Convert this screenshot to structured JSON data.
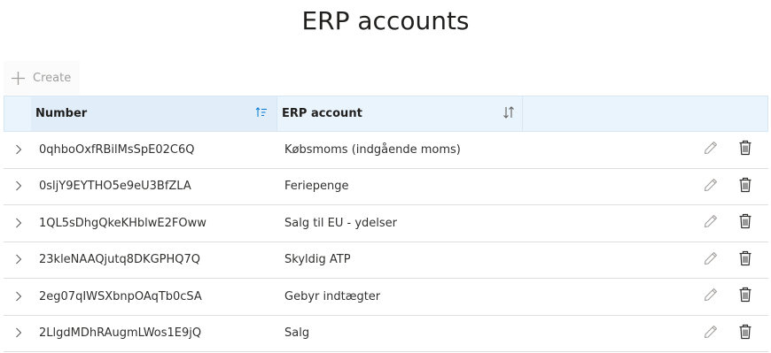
{
  "page": {
    "title": "ERP accounts"
  },
  "toolbar": {
    "create_label": "Create",
    "create_icon": "plus-icon"
  },
  "table": {
    "columns": [
      {
        "label": "Number",
        "sort": "ascending",
        "icon": "sort-ascending-icon"
      },
      {
        "label": "ERP account",
        "sort": "none",
        "icon": "sort-icon"
      }
    ],
    "rows": [
      {
        "number": "0qhboOxfRBilMsSpE02C6Q",
        "erp_account": "Købsmoms (indgående moms)"
      },
      {
        "number": "0sljY9EYTHO5e9eU3BfZLA",
        "erp_account": "Feriepenge"
      },
      {
        "number": "1QL5sDhgQkeKHblwE2FOww",
        "erp_account": "Salg til EU - ydelser"
      },
      {
        "number": "23kleNAAQjutq8DKGPHQ7Q",
        "erp_account": "Skyldig ATP"
      },
      {
        "number": "2eg07qIWSXbnpOAqTb0cSA",
        "erp_account": "Gebyr indtægter"
      },
      {
        "number": "2LlgdMDhRAugmLWos1E9jQ",
        "erp_account": "Salg"
      }
    ]
  },
  "colors": {
    "header_bg": "#eaf4fc",
    "sorted_header_bg": "#e1eefa",
    "accent": "#0078d4",
    "row_border": "#e1dfdd"
  }
}
